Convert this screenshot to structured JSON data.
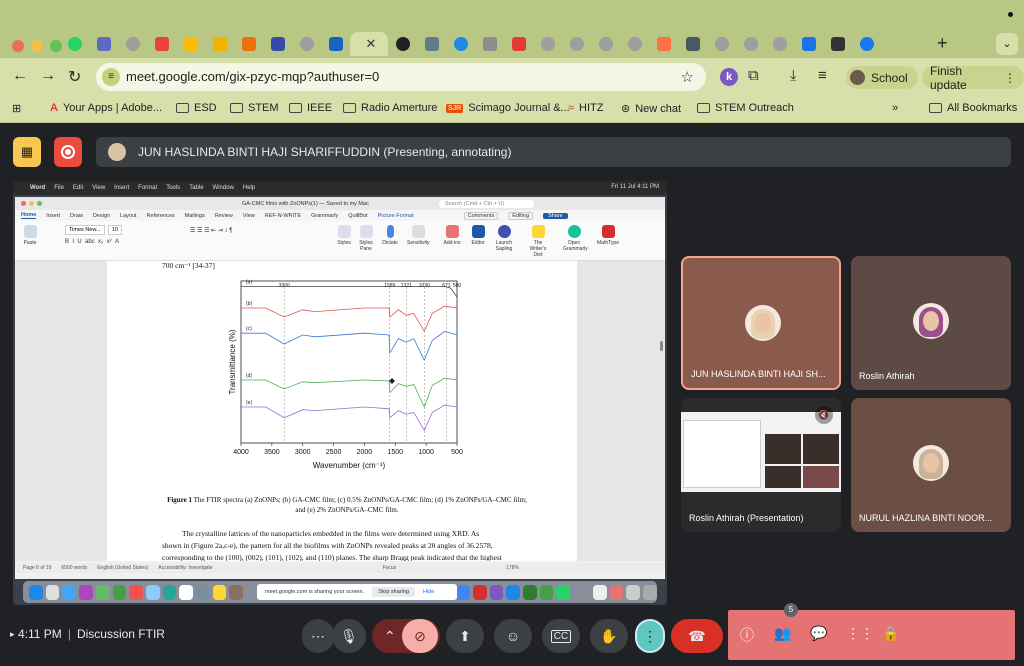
{
  "browser": {
    "url": "meet.google.com/gix-pzyc-mqp?authuser=0",
    "profile_label": "School",
    "update_label": "Finish update",
    "bookmarks": [
      "Your Apps | Adobe...",
      "ESD",
      "STEM",
      "IEEE",
      "Radio Amerture",
      "Scimago Journal &...",
      "HITZ",
      "New chat",
      "STEM Outreach"
    ],
    "all_bookmarks_label": "All Bookmarks",
    "more_label": "»"
  },
  "meet": {
    "presenter_text": "JUN HASLINDA BINTI HAJI SHARIFFUDDIN (Presenting, annotating)",
    "time": "4:11 PM",
    "meeting_name": "Discussion FTIR",
    "participant_count": "5",
    "tiles": [
      {
        "name": "JUN HASLINDA BINTI HAJI SH..."
      },
      {
        "name": "Roslin Athirah"
      },
      {
        "name": "Roslin Athirah (Presentation)"
      },
      {
        "name": "NURUL HAZLINA BINTI NOOR..."
      }
    ]
  },
  "shared_screen": {
    "menubar": [
      "Word",
      "File",
      "Edit",
      "View",
      "Insert",
      "Format",
      "Tools",
      "Table",
      "Window",
      "Help"
    ],
    "menubar_right": "Fri 11 Jul  4:11 PM",
    "doc_title": "GA-CMC films with ZnONPs(1) — Saved to my Mac",
    "search_placeholder": "Search (Cmd + Ctrl + U)",
    "ribbon_tabs": [
      "Home",
      "Insert",
      "Draw",
      "Design",
      "Layout",
      "References",
      "Mailings",
      "Review",
      "View",
      "REF-N-WRITE",
      "Grammarly",
      "QuillBot",
      "Picture Format"
    ],
    "comments_label": "Comments",
    "editing_label": "Editing",
    "share_label": "Share",
    "font_name": "Times New...",
    "font_size": "10",
    "ribbon_buttons": [
      "Paste",
      "Styles",
      "Styles Pane",
      "Dictate",
      "Sensitivity",
      "Add-ins",
      "Editor",
      "Launch Sapling",
      "The Writer's Diet",
      "Open Grammarly",
      "MathType"
    ],
    "doc_top_line": "700 cm⁻¹ [34-37]",
    "caption_bold": "Figure 1",
    "caption_text": " The FTIR spectra (a) ZnONPs; (b) GA-CMC film; (c) 0.5% ZnONPs/GA-CMC film; (d) 1% ZnONPs/GA–CMC film; and (e) 2% ZnONPs/GA–CMC film.",
    "para_lines": [
      "The crystalline lattices of the nanoparticles embedded in the films were determined using XRD. As",
      "shown in (Figure 2a,c-e), the pattern for all the biofilms with ZnONPs revealed peaks at 2θ angles of 36.2578,",
      "corresponding to the (100), (002), (101), (102), and (110) planes. The sharp Bragg peak indicated that the highest"
    ],
    "status": [
      "Page 6 of 19",
      "6500 words",
      "English (United States)",
      "Accessibility: Investigate",
      "Focus",
      "178%"
    ],
    "sharing_text": "meet.google.com is sharing your screen.",
    "stop_sharing": "Stop sharing",
    "hide": "Hide"
  },
  "chart_data": {
    "type": "line",
    "xlabel": "Wavenumber (cm⁻¹)",
    "ylabel": "Transmittance (%)",
    "xlim": [
      4000,
      500
    ],
    "x_ticks": [
      4000,
      3500,
      3000,
      2500,
      2000,
      1500,
      1000,
      500
    ],
    "peak_labels": [
      "3300",
      "1589",
      "1321",
      "1030",
      "671",
      "500"
    ],
    "peak_positions": [
      3300,
      1589,
      1321,
      1030,
      671,
      500
    ],
    "series": [
      {
        "name": "(a)",
        "color": "#444444",
        "points": [
          [
            4000,
            6
          ],
          [
            3000,
            6
          ],
          [
            2000,
            6
          ],
          [
            1000,
            6
          ],
          [
            700,
            6
          ],
          [
            600,
            8
          ],
          [
            500,
            18
          ]
        ]
      },
      {
        "name": "(b)",
        "color": "#d9534f",
        "points": [
          [
            4000,
            30
          ],
          [
            3600,
            30
          ],
          [
            3300,
            40
          ],
          [
            3000,
            32
          ],
          [
            2800,
            34
          ],
          [
            2000,
            30
          ],
          [
            1600,
            30
          ],
          [
            1589,
            40
          ],
          [
            1450,
            32
          ],
          [
            1321,
            38
          ],
          [
            1200,
            36
          ],
          [
            1030,
            56
          ],
          [
            900,
            36
          ],
          [
            700,
            28
          ],
          [
            500,
            30
          ]
        ]
      },
      {
        "name": "(c)",
        "color": "#3a78c9",
        "points": [
          [
            4000,
            58
          ],
          [
            3600,
            58
          ],
          [
            3300,
            70
          ],
          [
            3000,
            60
          ],
          [
            2800,
            62
          ],
          [
            2000,
            58
          ],
          [
            1600,
            60
          ],
          [
            1589,
            80
          ],
          [
            1450,
            64
          ],
          [
            1321,
            68
          ],
          [
            1200,
            64
          ],
          [
            1030,
            88
          ],
          [
            900,
            66
          ],
          [
            700,
            56
          ],
          [
            500,
            60
          ]
        ]
      },
      {
        "name": "(d)",
        "color": "#4caf50",
        "points": [
          [
            4000,
            110
          ],
          [
            3600,
            110
          ],
          [
            3300,
            120
          ],
          [
            3000,
            112
          ],
          [
            2800,
            113
          ],
          [
            2000,
            110
          ],
          [
            1600,
            111
          ],
          [
            1589,
            124
          ],
          [
            1450,
            114
          ],
          [
            1321,
            117
          ],
          [
            1200,
            115
          ],
          [
            1030,
            140
          ],
          [
            900,
            116
          ],
          [
            700,
            108
          ],
          [
            500,
            110
          ]
        ]
      },
      {
        "name": "(e)",
        "color": "#9c6ad0",
        "points": [
          [
            4000,
            140
          ],
          [
            3600,
            140
          ],
          [
            3300,
            152
          ],
          [
            3000,
            143
          ],
          [
            2800,
            144
          ],
          [
            2000,
            140
          ],
          [
            1600,
            142
          ],
          [
            1589,
            152
          ],
          [
            1450,
            144
          ],
          [
            1321,
            148
          ],
          [
            1200,
            146
          ],
          [
            1030,
            166
          ],
          [
            900,
            146
          ],
          [
            700,
            138
          ],
          [
            500,
            140
          ]
        ]
      }
    ]
  }
}
